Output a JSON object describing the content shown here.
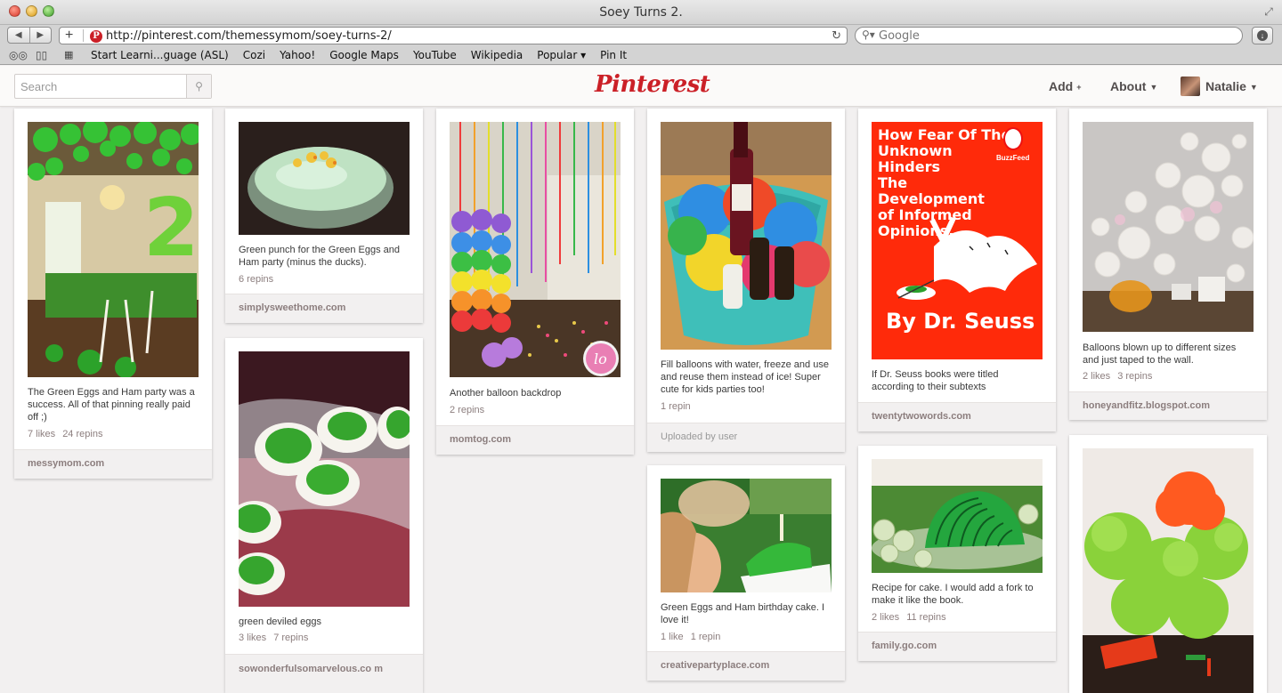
{
  "browser": {
    "window_title": "Soey Turns 2.",
    "url": "http://pinterest.com/themessymom/soey-turns-2/",
    "search_placeholder": "Google",
    "bookmarks": [
      "Start Learni...guage (ASL)",
      "Cozi",
      "Yahoo!",
      "Google Maps",
      "YouTube",
      "Wikipedia",
      "Popular ▾",
      "Pin It"
    ]
  },
  "header": {
    "search_placeholder": "Search",
    "logo": "Pinterest",
    "nav": {
      "add": "Add",
      "about": "About",
      "user": "Natalie"
    }
  },
  "pins": [
    {
      "desc": "The Green Eggs and Ham party was a success. All of that pinning really paid off ;)",
      "likes": "7 likes",
      "repins": "24 repins",
      "source": "messymom.com"
    },
    {
      "desc": "Green punch for the Green Eggs and Ham party (minus the ducks).",
      "likes": "",
      "repins": "6 repins",
      "source": "simplysweethome.com"
    },
    {
      "desc": "green deviled eggs",
      "likes": "3 likes",
      "repins": "7 repins",
      "source": "sowonderfulsomarvelous.co m"
    },
    {
      "desc": "Another balloon backdrop",
      "likes": "",
      "repins": "2 repins",
      "source": "momtog.com"
    },
    {
      "desc": "Fill balloons with water, freeze and use and reuse them instead of ice! Super cute for kids parties too!",
      "likes": "",
      "repins": "1 repin",
      "source": "Uploaded by user"
    },
    {
      "desc": "Green Eggs and Ham birthday cake. I love it!",
      "likes": "1 like",
      "repins": "1 repin",
      "source": "creativepartyplace.com"
    },
    {
      "desc": "If Dr. Seuss books were titled according to their subtexts",
      "likes": "",
      "repins": "",
      "source": "twentytwowords.com"
    },
    {
      "desc": "Recipe for cake. I would add a fork to make it like the book.",
      "likes": "2 likes",
      "repins": "11 repins",
      "source": "family.go.com"
    },
    {
      "desc": "Balloons blown up to different sizes and just taped to the wall.",
      "likes": "2 likes",
      "repins": "3 repins",
      "source": "honeyandfitz.blogspot.com"
    }
  ],
  "book": {
    "title_lines": [
      "How Fear Of The",
      "Unknown Hinders",
      "The Development",
      "of Informed",
      "Opinions."
    ],
    "badge": "BuzzFeed",
    "author": "By Dr. Seuss",
    "colors": {
      "cover": "#ff2a0a",
      "text": "#ffffff"
    }
  },
  "colors": {
    "brand": "#cb2027",
    "page_bg": "#f2f0f0",
    "meta_text": "#8c7e7e"
  }
}
